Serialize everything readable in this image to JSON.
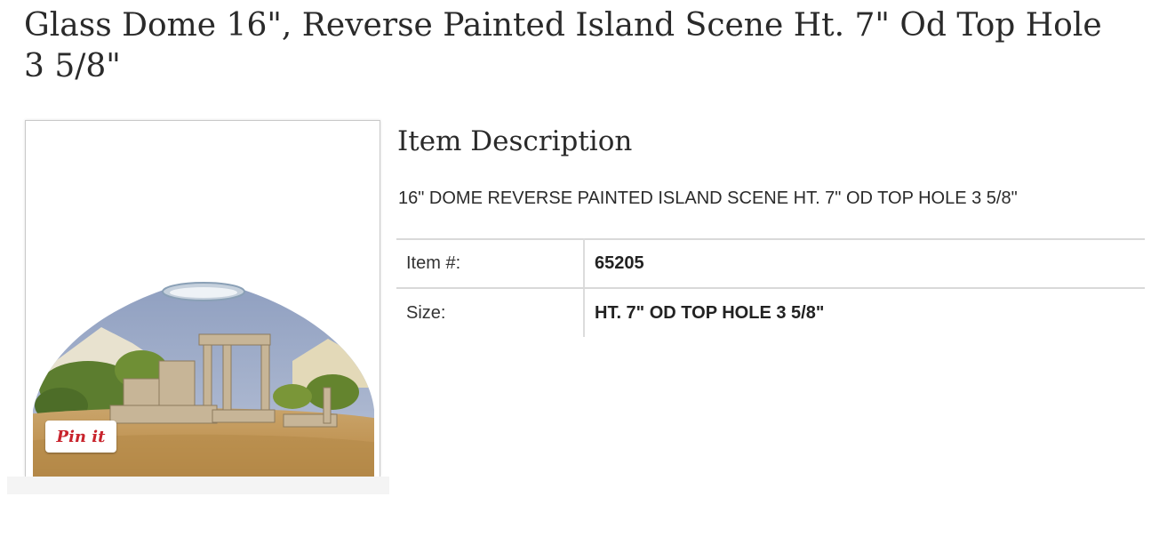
{
  "product": {
    "title": "Glass Dome 16\", Reverse Painted Island Scene Ht. 7\" Od Top Hole 3 5/8\""
  },
  "image": {
    "pin_label": "Pin it",
    "pin_color": "#c8232c"
  },
  "description": {
    "heading": "Item Description",
    "text": "16\" DOME REVERSE PAINTED ISLAND SCENE HT. 7\" OD TOP HOLE 3 5/8\""
  },
  "details": [
    {
      "label": "Item #:",
      "value": "65205"
    },
    {
      "label": "Size:",
      "value": "HT. 7\" OD TOP HOLE 3 5/8\""
    }
  ]
}
